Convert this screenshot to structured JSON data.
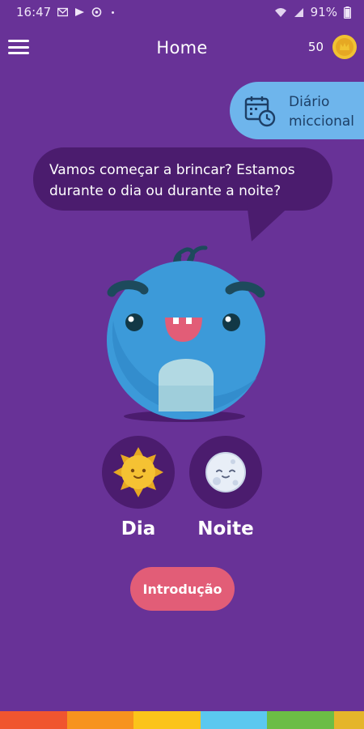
{
  "status_bar": {
    "time": "16:47",
    "battery": "91%"
  },
  "app_bar": {
    "title": "Home",
    "coins": "50"
  },
  "diary": {
    "label": "Diário miccional"
  },
  "speech_bubble": {
    "text": "Vamos começar a brincar? Estamos durante o dia ou durante a noite?"
  },
  "choices": {
    "day_label": "Dia",
    "night_label": "Noite"
  },
  "intro_button": {
    "label": "Introdução"
  },
  "colors": {
    "background": "#683297",
    "bubble": "#4b1c6e",
    "diary_button": "#6eb5ec",
    "intro_button": "#e25d77",
    "mascot": "#3c9ad9",
    "coin": "#f1c232",
    "stripe": [
      "#f0552f",
      "#f7931e",
      "#fbc41a",
      "#5bc8ef",
      "#6cbd45",
      "#e5b52a"
    ]
  }
}
